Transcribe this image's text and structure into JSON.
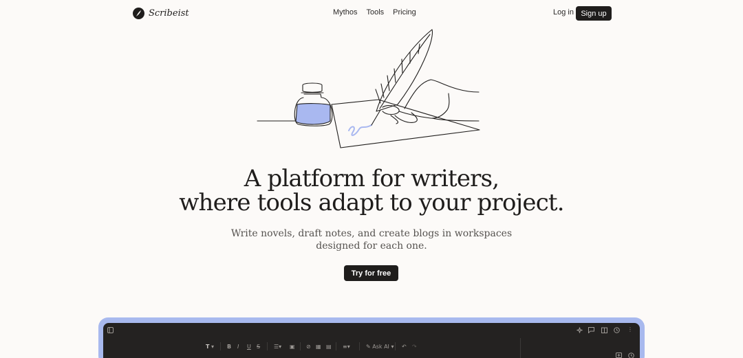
{
  "nav": {
    "brand": "Scribeist",
    "links": [
      "Mythos",
      "Tools",
      "Pricing"
    ],
    "login": "Log in",
    "signup": "Sign up"
  },
  "hero": {
    "headline_line1": "A platform for writers,",
    "headline_line2": "where tools adapt to your project.",
    "sub_line1": "Write novels, draft notes, and create blogs in workspaces",
    "sub_line2": "designed for each one.",
    "cta": "Try for free"
  },
  "editor": {
    "text_style": "T",
    "ask_ai": "Ask AI",
    "icons": [
      "sidebar-toggle-icon",
      "text-style-icon",
      "bold-icon",
      "italic-icon",
      "underline-icon",
      "strikethrough-icon",
      "list-icon",
      "image-icon",
      "link-icon",
      "table-icon",
      "embed-icon",
      "align-icon",
      "ask-ai-icon",
      "undo-icon",
      "redo-icon",
      "ai-sparkle-icon",
      "comment-icon",
      "book-icon",
      "history-icon",
      "more-icon",
      "panel-add-icon",
      "history-panel-icon"
    ]
  },
  "colors": {
    "background": "#fcfaf8",
    "dark": "#1f1d1c",
    "accent": "#a8b9ee",
    "ink": "#a9b8f0"
  }
}
